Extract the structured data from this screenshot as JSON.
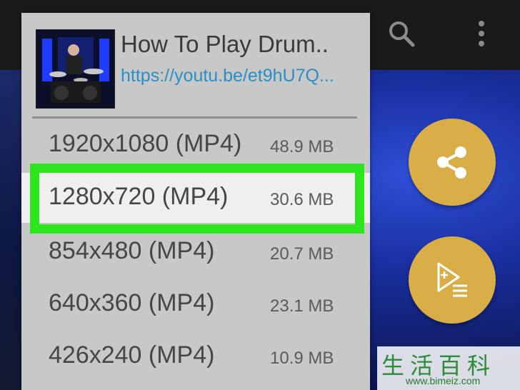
{
  "app": {
    "toolbar": {
      "search_icon": "search-icon",
      "more_icon": "more-vert-icon"
    },
    "video": {
      "title": "How To Play Drum..",
      "url": "https://youtu.be/et9hU7Q..."
    },
    "formats": [
      {
        "resolution": "1920x1080 (MP4)",
        "size": "48.9 MB",
        "selected": false
      },
      {
        "resolution": "1280x720 (MP4)",
        "size": "30.6 MB",
        "selected": true
      },
      {
        "resolution": "854x480 (MP4)",
        "size": "20.7 MB",
        "selected": false
      },
      {
        "resolution": "640x360 (MP4)",
        "size": "23.1 MB",
        "selected": false
      },
      {
        "resolution": "426x240 (MP4)",
        "size": "10.9 MB",
        "selected": false
      }
    ],
    "fabs": {
      "share_icon": "share-icon",
      "playlist_add_icon": "playlist-add-icon"
    },
    "colors": {
      "panel_bg": "#c8c8c8",
      "selected_row_bg": "#efefef",
      "highlight_border": "#2ee61f",
      "fab_color": "#d9ae46",
      "url_color": "#2a8fc4"
    }
  },
  "watermark": {
    "chinese": "生活百科",
    "url": "www.bimeiz.com"
  }
}
